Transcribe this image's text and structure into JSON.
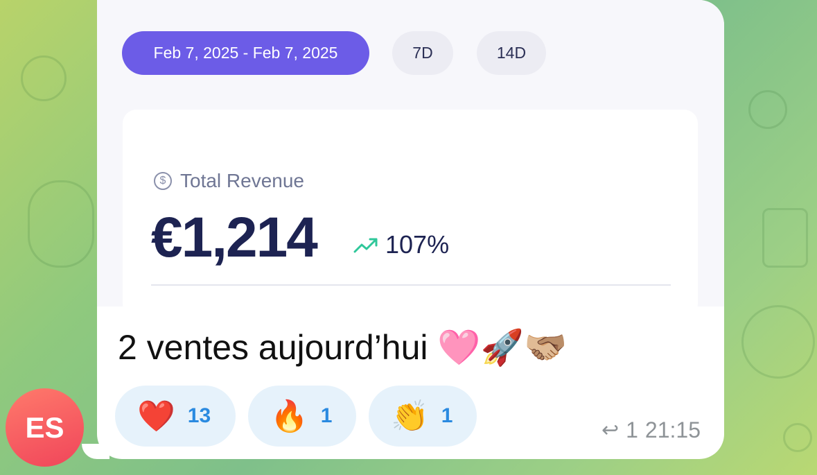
{
  "date_filter": {
    "range_label": "Feb 7, 2025 - Feb 7, 2025",
    "options": [
      "7D",
      "14D"
    ]
  },
  "revenue": {
    "label": "Total Revenue",
    "value": "€1,214",
    "growth": "107%",
    "growth_icon": "trend-up-icon"
  },
  "message": {
    "text": "2 ventes aujourd’hui 🩷🚀🫱🏼‍🫲🏽"
  },
  "reactions": [
    {
      "emoji": "❤️",
      "count": "13"
    },
    {
      "emoji": "🔥",
      "count": "1"
    },
    {
      "emoji": "👏",
      "count": "1"
    }
  ],
  "meta": {
    "reply_count": "1",
    "time": "21:15"
  },
  "avatar": {
    "initials": "ES"
  },
  "colors": {
    "accent": "#6c5ce7",
    "reaction_bg": "#e6f2fb",
    "reaction_count": "#2a8ae0",
    "avatar": "#f0455a"
  }
}
